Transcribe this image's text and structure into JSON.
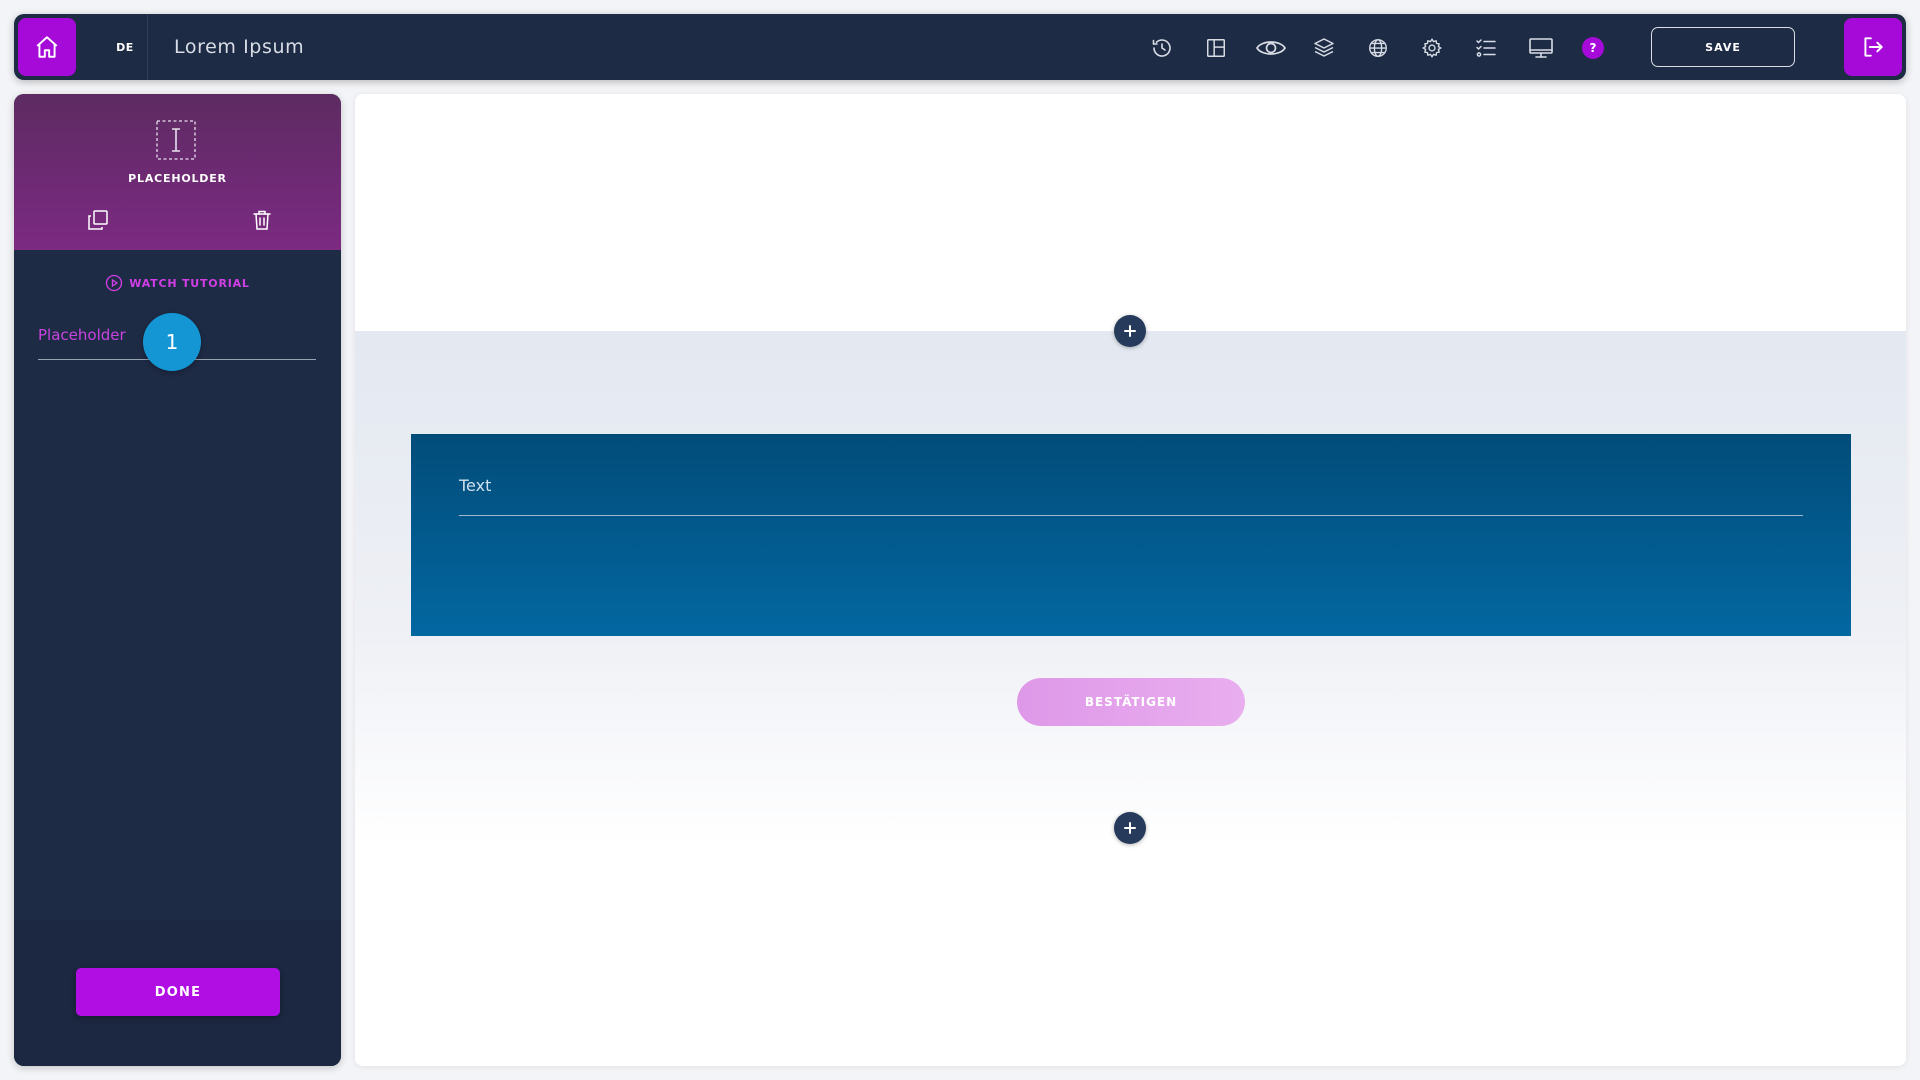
{
  "topbar": {
    "language": "DE",
    "title": "Lorem Ipsum",
    "help_label": "?",
    "save_label": "SAVE",
    "tools": [
      "history-icon",
      "layout-icon",
      "eye-icon",
      "layers-icon",
      "globe-icon",
      "gear-icon",
      "checklist-icon",
      "monitor-icon"
    ]
  },
  "panel": {
    "element_title": "PLACEHOLDER",
    "tutorial_label": "WATCH TUTORIAL",
    "field_label": "Placeholder",
    "step_number": "1",
    "done_label": "DONE"
  },
  "canvas": {
    "text_field_value": "Text",
    "confirm_label": "BESTÄTIGEN"
  },
  "colors": {
    "accent": "#a50ad8",
    "topbar_bg": "#1e2b45",
    "step_badge": "#1596d4",
    "block_blue": "#035a8e"
  }
}
